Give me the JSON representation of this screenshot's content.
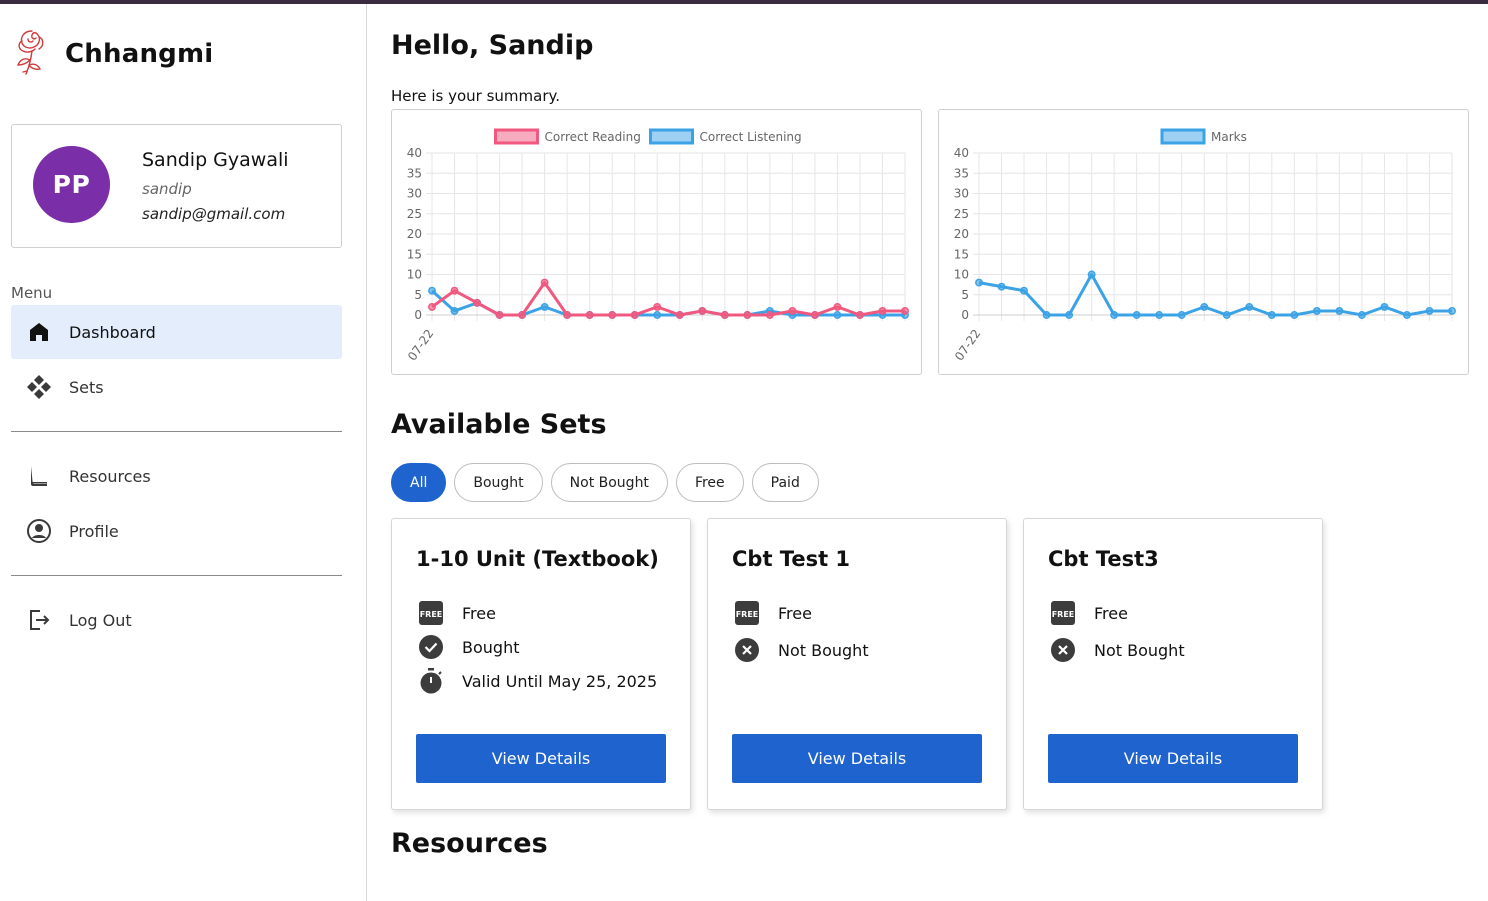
{
  "brand": {
    "name": "Chhangmi",
    "logo_icon": "rose-icon",
    "logo_color": "#d23a3a"
  },
  "user": {
    "initials": "PP",
    "full_name": "Sandip Gyawali",
    "username": "sandip",
    "email": "sandip@gmail.com",
    "avatar_color": "#7a2ea8"
  },
  "menu": {
    "label": "Menu",
    "items": [
      {
        "label": "Dashboard",
        "icon": "home-icon",
        "active": true
      },
      {
        "label": "Sets",
        "icon": "diamond-grid-icon"
      },
      {
        "label": "Resources",
        "icon": "book-icon"
      },
      {
        "label": "Profile",
        "icon": "account-circle-icon"
      },
      {
        "label": "Log Out",
        "icon": "logout-icon"
      }
    ]
  },
  "main": {
    "greeting": "Hello, Sandip",
    "summary": "Here is your summary."
  },
  "chart_data": [
    {
      "type": "line",
      "x_first_label": "07-22",
      "ylim": [
        0,
        40
      ],
      "yticks": [
        0,
        5,
        10,
        15,
        20,
        25,
        30,
        35,
        40
      ],
      "legend_position": "top-center",
      "grid": true,
      "series": [
        {
          "name": "Correct Reading",
          "color": "#f0587f",
          "values": [
            2,
            6,
            3,
            0,
            0,
            8,
            0,
            0,
            0,
            0,
            2,
            0,
            1,
            0,
            0,
            0,
            1,
            0,
            2,
            0,
            1,
            1
          ]
        },
        {
          "name": "Correct Listening",
          "color": "#3ba2e6",
          "values": [
            6,
            1,
            3,
            0,
            0,
            2,
            0,
            0,
            0,
            0,
            0,
            0,
            1,
            0,
            0,
            1,
            0,
            0,
            0,
            0,
            0,
            0
          ]
        }
      ]
    },
    {
      "type": "line",
      "x_first_label": "07-22",
      "ylim": [
        0,
        40
      ],
      "yticks": [
        0,
        5,
        10,
        15,
        20,
        25,
        30,
        35,
        40
      ],
      "legend_position": "top-center",
      "grid": true,
      "series": [
        {
          "name": "Marks",
          "color": "#3ba2e6",
          "values": [
            8,
            7,
            6,
            0,
            0,
            10,
            0,
            0,
            0,
            0,
            2,
            0,
            2,
            0,
            0,
            1,
            1,
            0,
            2,
            0,
            1,
            1
          ]
        }
      ]
    }
  ],
  "sets_section": {
    "title": "Available Sets",
    "filters": [
      {
        "label": "All",
        "active": true
      },
      {
        "label": "Bought"
      },
      {
        "label": "Not Bought"
      },
      {
        "label": "Free"
      },
      {
        "label": "Paid"
      }
    ],
    "cards": [
      {
        "title": "1-10 Unit (Textbook)",
        "price": "Free",
        "status": "Bought",
        "status_icon": "check-circle-icon",
        "validity": "Valid Until May 25, 2025",
        "button": "View Details"
      },
      {
        "title": "Cbt Test 1",
        "price": "Free",
        "status": "Not Bought",
        "status_icon": "cancel-circle-icon",
        "button": "View Details"
      },
      {
        "title": "Cbt Test3",
        "price": "Free",
        "status": "Not Bought",
        "status_icon": "cancel-circle-icon",
        "button": "View Details"
      }
    ]
  },
  "resources_section": {
    "title": "Resources"
  },
  "colors": {
    "primary": "#1f63cf",
    "active_nav_bg": "#e3edfc",
    "top_bar": "#3a2c3e"
  }
}
